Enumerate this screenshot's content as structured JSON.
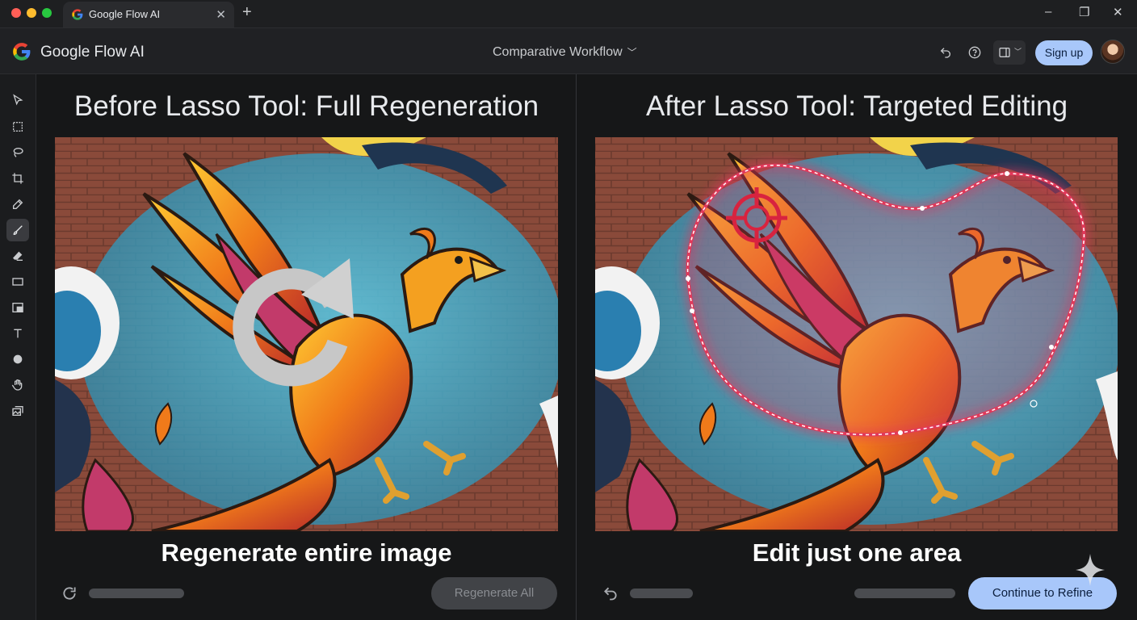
{
  "browser": {
    "tab_title": "Google Flow AI",
    "tab_close": "✕",
    "new_tab": "+",
    "window_controls": [
      "–",
      "❐",
      "✕"
    ]
  },
  "header": {
    "app_name": "Google Flow AI",
    "workflow_label": "Comparative Workflow",
    "signup_label": "Sign up",
    "icons": [
      "undo-icon",
      "help-icon",
      "layout-toggle-icon"
    ]
  },
  "toolbar": {
    "tools": [
      "select-arrow",
      "marquee",
      "lasso",
      "crop",
      "eyedropper",
      "brush",
      "eraser",
      "rectangle",
      "layers",
      "text",
      "circle",
      "hand",
      "image-stack"
    ],
    "active_tool": "brush"
  },
  "left_panel": {
    "title": "Before Lasso Tool: Full Regeneration",
    "caption": "Regenerate entire image",
    "button_label": "Regenerate All",
    "button_state": "disabled"
  },
  "right_panel": {
    "title": "After Lasso Tool: Targeted Editing",
    "caption": "Edit just one area",
    "button_label": "Continue to Refine"
  },
  "colors": {
    "accent": "#a8c7fa",
    "lasso": "#e2385a",
    "background": "#161718"
  }
}
